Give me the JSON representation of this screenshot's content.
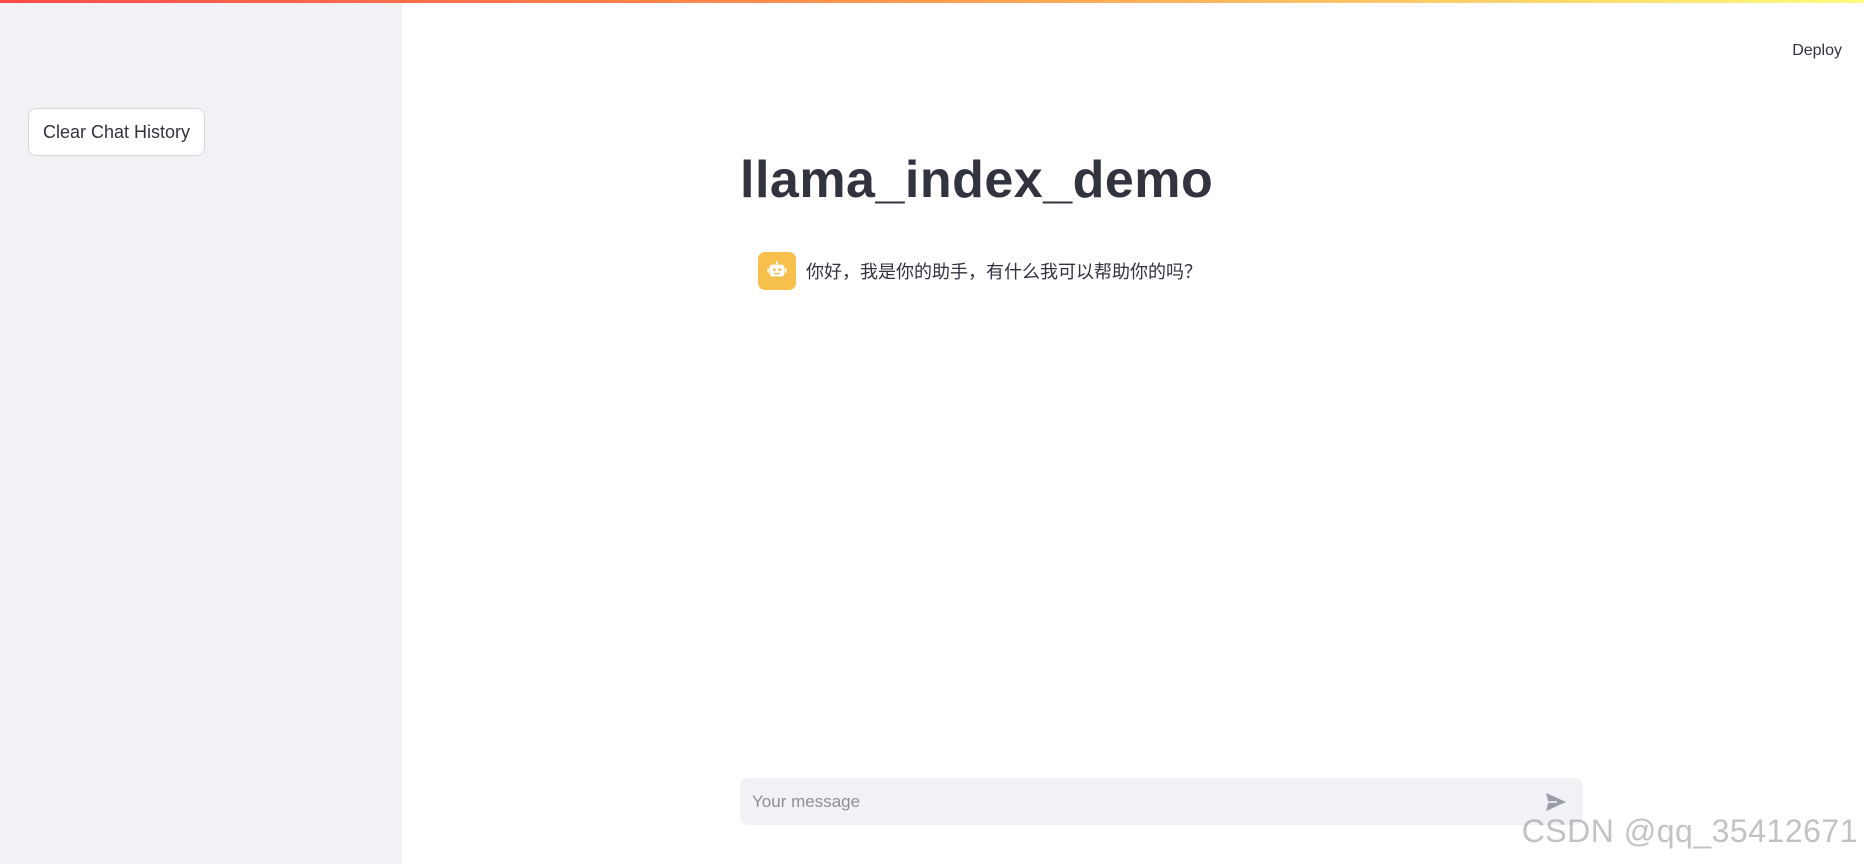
{
  "header": {
    "deploy_label": "Deploy"
  },
  "sidebar": {
    "clear_button_label": "Clear Chat History"
  },
  "main": {
    "title": "llama_index_demo",
    "messages": [
      {
        "role": "assistant",
        "avatar_icon": "robot-icon",
        "text": "你好，我是你的助手，有什么我可以帮助你的吗？"
      }
    ]
  },
  "chat_input": {
    "placeholder": "Your message",
    "value": "",
    "send_icon": "send-icon"
  },
  "watermark": {
    "text": "CSDN @qq_35412671"
  },
  "colors": {
    "sidebar_bg": "#f0f2f6",
    "avatar_bg": "#f7c04d",
    "text": "#31333f",
    "input_bg": "#f0f2f6"
  }
}
